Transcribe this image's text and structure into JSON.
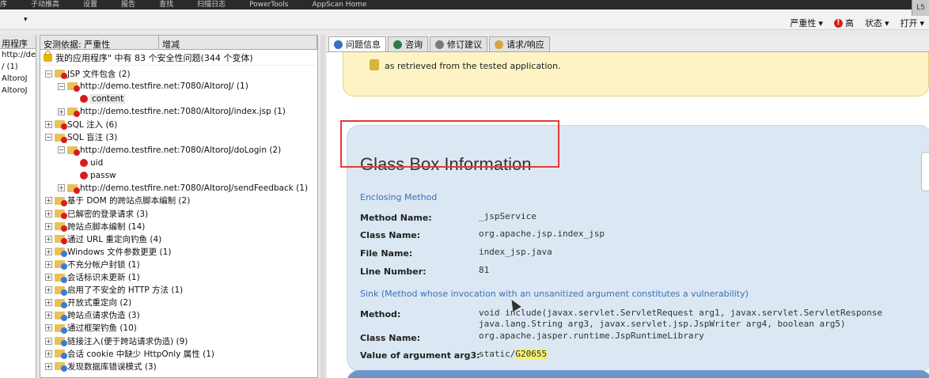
{
  "topstrip": [
    "序",
    "子动推高",
    "设置",
    "报告",
    "查找",
    "扫描日志",
    "PowerTools",
    "AppScan Home"
  ],
  "toolbar": {
    "dropdown": "▾",
    "severity": "严重性",
    "high": "高",
    "status": "状态",
    "open": "打开",
    "corner": "L5"
  },
  "left_column": {
    "header": "用程序",
    "rows": [
      "http://dem",
      "/ (1)",
      "AltoroJ",
      "AltoroJ"
    ]
  },
  "tree": {
    "col_headers": [
      "安测依据: 严重性",
      "增减"
    ],
    "summary": "我的应用程序\" 中有 83 个安全性问题(344 个变体)",
    "nodes": [
      {
        "indent": 0,
        "exp": "⊟",
        "icon": "red",
        "label": "JSP 文件包含 (2)"
      },
      {
        "indent": 1,
        "exp": "⊟",
        "icon": "red",
        "label": "http://demo.testfire.net:7080/AltoroJ/ (1)"
      },
      {
        "indent": 2,
        "exp": "",
        "icon": "dot",
        "label": "content",
        "hl": true
      },
      {
        "indent": 1,
        "exp": "⊞",
        "icon": "red",
        "label": "http://demo.testfire.net:7080/AltoroJ/index.jsp (1)"
      },
      {
        "indent": 0,
        "exp": "⊞",
        "icon": "red",
        "label": "SQL 注入 (6)"
      },
      {
        "indent": 0,
        "exp": "⊟",
        "icon": "red",
        "label": "SQL 盲注 (3)"
      },
      {
        "indent": 1,
        "exp": "⊟",
        "icon": "red",
        "label": "http://demo.testfire.net:7080/AltoroJ/doLogin (2)"
      },
      {
        "indent": 2,
        "exp": "",
        "icon": "dot",
        "label": "uid"
      },
      {
        "indent": 2,
        "exp": "",
        "icon": "dot",
        "label": "passw"
      },
      {
        "indent": 1,
        "exp": "⊞",
        "icon": "red",
        "label": "http://demo.testfire.net:7080/AltoroJ/sendFeedback (1)"
      },
      {
        "indent": 0,
        "exp": "⊞",
        "icon": "red",
        "label": "基于 DOM 的跨站点脚本编制 (2)"
      },
      {
        "indent": 0,
        "exp": "⊞",
        "icon": "red",
        "label": "已解密的登录请求 (3)"
      },
      {
        "indent": 0,
        "exp": "⊞",
        "icon": "red",
        "label": "跨站点脚本编制 (14)"
      },
      {
        "indent": 0,
        "exp": "⊞",
        "icon": "red",
        "label": "通过 URL 重定向钓鱼 (4)"
      },
      {
        "indent": 0,
        "exp": "⊞",
        "icon": "blue",
        "label": "Windows 文件参数更更 (1)"
      },
      {
        "indent": 0,
        "exp": "⊞",
        "icon": "blue",
        "label": "不充分帐户封锁 (1)"
      },
      {
        "indent": 0,
        "exp": "⊞",
        "icon": "blue",
        "label": "会话标识未更新 (1)"
      },
      {
        "indent": 0,
        "exp": "⊞",
        "icon": "blue",
        "label": "启用了不安全的 HTTP 方法 (1)"
      },
      {
        "indent": 0,
        "exp": "⊞",
        "icon": "blue",
        "label": "开放式重定向 (2)"
      },
      {
        "indent": 0,
        "exp": "⊞",
        "icon": "blue",
        "label": "跨站点请求伪造 (3)"
      },
      {
        "indent": 0,
        "exp": "⊞",
        "icon": "blue",
        "label": "通过框架钓鱼 (10)"
      },
      {
        "indent": 0,
        "exp": "⊞",
        "icon": "blue",
        "label": "链接注入(便于跨站请求伪造) (9)"
      },
      {
        "indent": 0,
        "exp": "⊞",
        "icon": "blue",
        "label": "会话 cookie 中缺少 HttpOnly 属性 (1)"
      },
      {
        "indent": 0,
        "exp": "⊞",
        "icon": "blue",
        "label": "发现数据库错误模式 (3)"
      }
    ]
  },
  "tabs": [
    {
      "label": "问题信息",
      "color": "#3a6fc4",
      "active": true
    },
    {
      "label": "咨询",
      "color": "#2d7d3f",
      "active": false
    },
    {
      "label": "修订建议",
      "color": "#7a7a7a",
      "active": false
    },
    {
      "label": "请求/响应",
      "color": "#d9a53b",
      "active": false
    }
  ],
  "details": {
    "retrieved_text": "as retrieved from the tested application.",
    "title": "Glass Box Information",
    "enclosing_label": "Enclosing Method",
    "method_name_key": "Method Name:",
    "method_name_val": "_jspService",
    "class_name_key": "Class Name:",
    "class_name_val": "org.apache.jsp.index_jsp",
    "file_name_key": "File Name:",
    "file_name_val": "index_jsp.java",
    "line_number_key": "Line Number:",
    "line_number_val": "81",
    "sink_label": "Sink (Method whose invocation with an unsanitized argument constitutes a vulnerability)",
    "method_key": "Method:",
    "method_val_1": "void include(javax.servlet.ServletRequest arg1, javax.servlet.ServletResponse",
    "method_val_2": "java.lang.String arg3, javax.servlet.jsp.JspWriter arg4, boolean arg5)",
    "sink_class_key": "Class Name:",
    "sink_class_val": "org.apache.jasper.runtime.JspRuntimeLibrary",
    "arg_key": "Value of argument arg3:",
    "arg_prefix": "static/",
    "arg_value": "G20655"
  }
}
